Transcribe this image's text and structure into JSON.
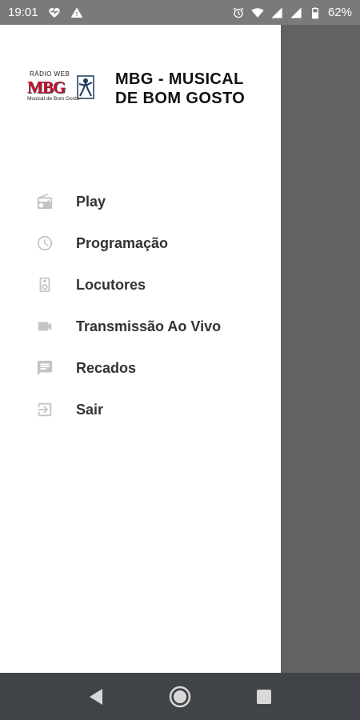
{
  "status_bar": {
    "time": "19:01",
    "battery": "62%",
    "left_icons": [
      "heart-monitor-icon",
      "warning-icon"
    ],
    "right_icons": [
      "alarm-icon",
      "wifi-icon",
      "signal-icon",
      "signal-icon",
      "battery-icon"
    ]
  },
  "drawer": {
    "logo": {
      "top_text": "RÁDIO WEB",
      "main_text": "MBG",
      "tagline": "Musical de Bom Gosto"
    },
    "title_line1": "MBG - MUSICAL",
    "title_line2": "DE BOM GOSTO",
    "menu": [
      {
        "label": "Play",
        "icon": "radio-icon"
      },
      {
        "label": "Programação",
        "icon": "clock-icon"
      },
      {
        "label": "Locutores",
        "icon": "speaker-icon"
      },
      {
        "label": "Transmissão Ao Vivo",
        "icon": "videocam-icon"
      },
      {
        "label": "Recados",
        "icon": "message-icon"
      },
      {
        "label": "Sair",
        "icon": "exit-icon"
      }
    ]
  },
  "nav_bar": {
    "buttons": [
      "back-icon",
      "home-icon",
      "recents-icon"
    ]
  },
  "colors": {
    "status_bar": "#7a7a7a",
    "drawer_bg": "#ffffff",
    "scrim": "#626262",
    "nav_bar": "#404347",
    "icon": "#c4c4c4",
    "logo_red": "#c8102e"
  }
}
